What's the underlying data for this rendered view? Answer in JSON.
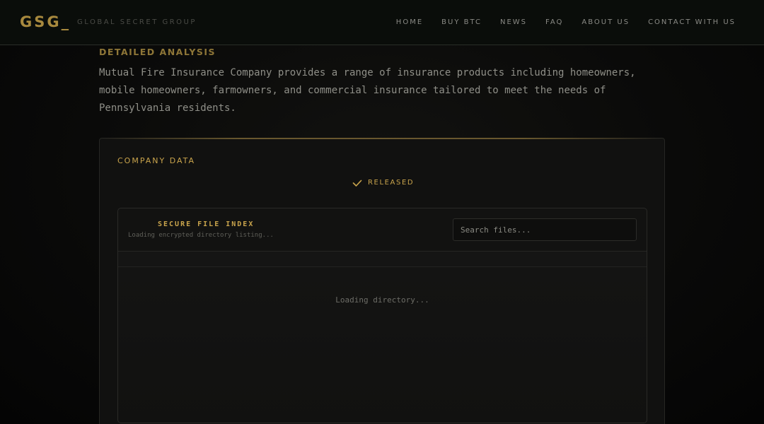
{
  "header": {
    "logo": "GSG_",
    "tagline": "GLOBAL SECRET GROUP",
    "nav": [
      {
        "label": "HOME"
      },
      {
        "label": "BUY BTC"
      },
      {
        "label": "NEWS"
      },
      {
        "label": "FAQ"
      },
      {
        "label": "ABOUT US"
      },
      {
        "label": "CONTACT WITH US"
      }
    ]
  },
  "main": {
    "section_title": "DETAILED ANALYSIS",
    "description": "Mutual Fire Insurance Company provides a range of insurance products including homeowners, mobile homeowners, farmowners, and commercial insurance tailored to meet the needs of Pennsylvania residents.",
    "card": {
      "title": "COMPANY DATA",
      "status_icon": "check-icon",
      "status": "RELEASED",
      "file_index": {
        "title": "SECURE FILE INDEX",
        "subtitle": "Loading encrypted directory listing...",
        "search_placeholder": "Search files...",
        "loading": "Loading directory..."
      }
    }
  },
  "colors": {
    "accent_gold": "#c9a44c",
    "logo_gold": "#a8893e",
    "background": "#0a0a09"
  }
}
